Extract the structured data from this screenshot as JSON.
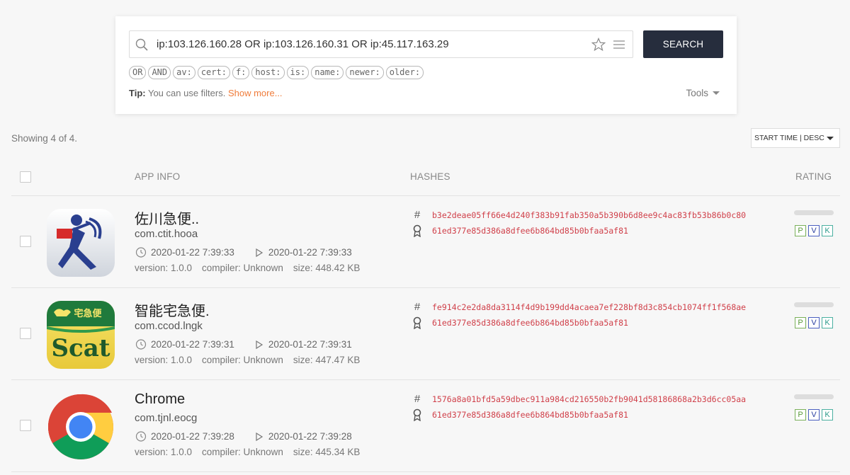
{
  "search": {
    "query": "ip:103.126.160.28 OR ip:103.126.160.31 OR ip:45.117.163.29",
    "button_label": "SEARCH",
    "filters": [
      "OR",
      "AND",
      "av:",
      "cert:",
      "f:",
      "host:",
      "is:",
      "name:",
      "newer:",
      "older:"
    ],
    "tip_label": "Tip:",
    "tip_text": " You can use filters. ",
    "tip_link": "Show more...",
    "tools_label": "Tools"
  },
  "results": {
    "showing": "Showing 4 of 4.",
    "sort": "START TIME | DESC"
  },
  "table": {
    "headers": {
      "app_info": "APP INFO",
      "hashes": "HASHES",
      "rating": "RATING"
    },
    "rows": [
      {
        "name": "佐川急便..",
        "package": "com.ctit.hooa",
        "created": "2020-01-22 7:39:33",
        "started": "2020-01-22 7:39:33",
        "version": "version: 1.0.0",
        "compiler": "compiler: Unknown",
        "size": "size: 448.42 KB",
        "hash": "b3e2deae05ff66e4d240f383b91fab350a5b390b6d8ee9c4ac83fb53b86b0c80",
        "cert": "61ed377e85d386a8dfee6b864bd85b0bfaa5af81",
        "icon": "sagawa-icon"
      },
      {
        "name": "智能宅急便.",
        "package": "com.ccod.lngk",
        "created": "2020-01-22 7:39:31",
        "started": "2020-01-22 7:39:31",
        "version": "version: 1.0.0",
        "compiler": "compiler: Unknown",
        "size": "size: 447.47 KB",
        "hash": "fe914c2e2da8da3114f4d9b199dd4acaea7ef228bf8d3c854cb1074ff1f568ae",
        "cert": "61ed377e85d386a8dfee6b864bd85b0bfaa5af81",
        "icon": "scat-icon",
        "icon_text": "Scat",
        "icon_banner": "宅急便"
      },
      {
        "name": "Chrome",
        "package": "com.tjnl.eocg",
        "created": "2020-01-22 7:39:28",
        "started": "2020-01-22 7:39:28",
        "version": "version: 1.0.0",
        "compiler": "compiler: Unknown",
        "size": "size: 445.34 KB",
        "hash": "1576a8a01bfd5a59dbec911a984cd216550b2fb9041d58186868a2b3d6cc05aa",
        "cert": "61ed377e85d386a8dfee6b864bd85b0bfaa5af81",
        "icon": "chrome-icon"
      }
    ],
    "badges": [
      "P",
      "V",
      "K"
    ]
  },
  "colors": {
    "search_button": "#262d3d",
    "hash_text": "#d0404a",
    "tip_link": "#f07c3a"
  }
}
